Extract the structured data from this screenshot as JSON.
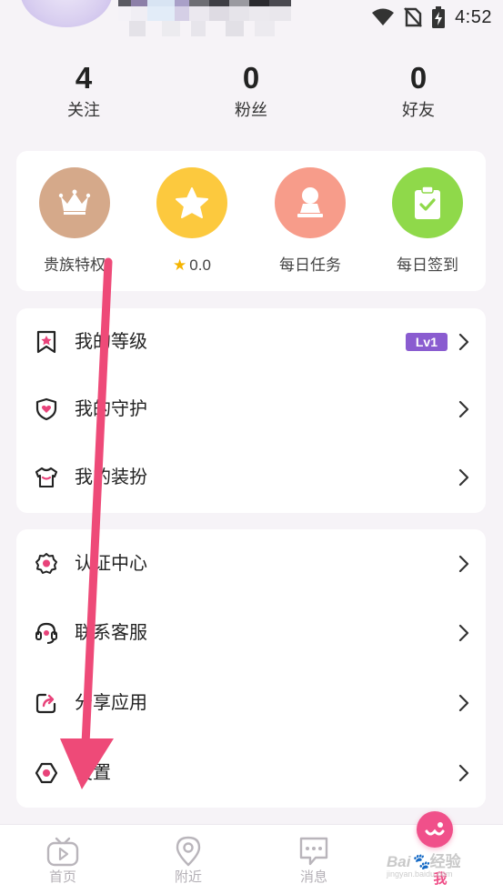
{
  "status_bar": {
    "time": "4:52"
  },
  "stats": [
    {
      "value": "4",
      "label": "关注"
    },
    {
      "value": "0",
      "label": "粉丝"
    },
    {
      "value": "0",
      "label": "好友"
    }
  ],
  "quick_actions": [
    {
      "label": "贵族特权",
      "color": "#d5a98a",
      "icon": "crown-icon"
    },
    {
      "label": "0.0",
      "color": "#fcc93e",
      "icon": "star-icon"
    },
    {
      "label": "每日任务",
      "color": "#f79c8a",
      "icon": "task-person-icon"
    },
    {
      "label": "每日签到",
      "color": "#8fd94a",
      "icon": "checkin-clipboard-icon"
    }
  ],
  "menu_group_1": [
    {
      "label": "我的等级",
      "badge": "Lv1",
      "icon": "level-bookmark-icon"
    },
    {
      "label": "我的守护",
      "icon": "shield-heart-icon"
    },
    {
      "label": "我的装扮",
      "icon": "shirt-icon"
    }
  ],
  "menu_group_2": [
    {
      "label": "认证中心",
      "icon": "badge-gear-icon"
    },
    {
      "label": "联系客服",
      "icon": "headset-icon"
    },
    {
      "label": "分享应用",
      "icon": "share-icon"
    },
    {
      "label": "设置",
      "icon": "settings-hexagon-icon"
    }
  ],
  "bottom_nav": [
    {
      "label": "首页",
      "icon": "tv-icon"
    },
    {
      "label": "附近",
      "icon": "location-pin-icon"
    },
    {
      "label": "消息",
      "icon": "chat-bubble-icon"
    },
    {
      "label": "我",
      "icon": "me-icon",
      "active": true
    }
  ],
  "watermark": {
    "text": "Bai",
    "sub": "jingyan.baidu.com"
  },
  "colors": {
    "accent": "#ef4c86",
    "badge": "#8a5cd0",
    "icon_pink": "#e8437a",
    "arrow": "#ee4a78"
  }
}
